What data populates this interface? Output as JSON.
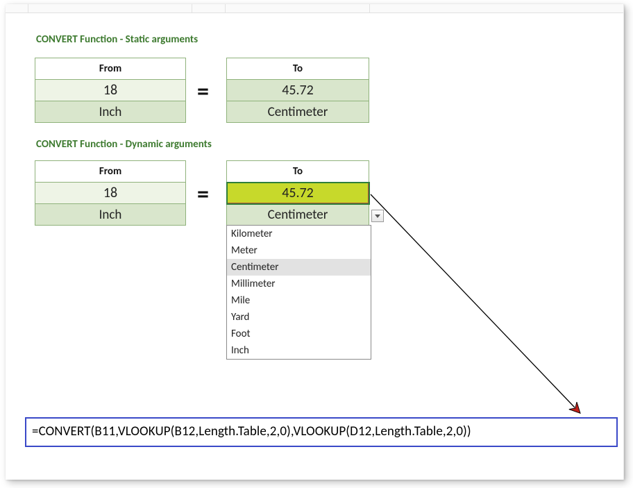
{
  "section1": {
    "title": "CONVERT Function - Static arguments"
  },
  "section2": {
    "title": "CONVERT Function - Dynamic arguments"
  },
  "static": {
    "from_header": "From",
    "to_header": "To",
    "from_value": "18",
    "to_value": "45.72",
    "from_unit": "Inch",
    "to_unit": "Centimeter",
    "equals": "="
  },
  "dynamic": {
    "from_header": "From",
    "to_header": "To",
    "from_value": "18",
    "to_value": "45.72",
    "from_unit": "Inch",
    "to_unit": "Centimeter",
    "equals": "="
  },
  "dropdown": {
    "options": [
      "Kilometer",
      "Meter",
      "Centimeter",
      "Millimeter",
      "Mile",
      "Yard",
      "Foot",
      "Inch"
    ],
    "hover_index": 2
  },
  "formula": {
    "text": "=CONVERT(B11,VLOOKUP(B12,Length.Table,2,0),VLOOKUP(D12,Length.Table,2,0))"
  }
}
